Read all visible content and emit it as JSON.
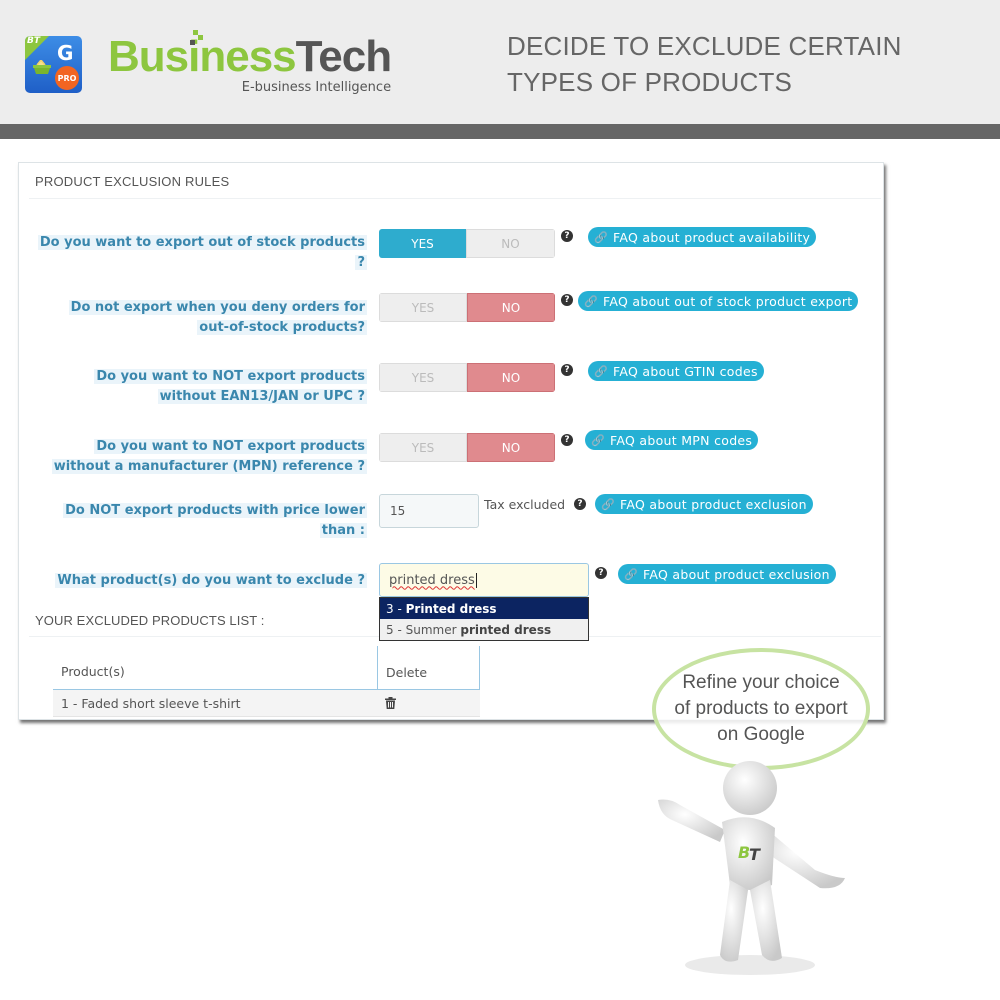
{
  "header": {
    "app_icon": {
      "corner_badge": "BT",
      "letter": "G",
      "badge": "PRO"
    },
    "logo": {
      "part1": "Business",
      "part2": "Tech",
      "tagline": "E-business Intelligence"
    },
    "headline_line1": "DECIDE TO EXCLUDE CERTAIN",
    "headline_line2": "TYPES OF PRODUCTS"
  },
  "panel": {
    "title": "PRODUCT EXCLUSION RULES",
    "rules": [
      {
        "label_line1": "Do you want to export out of stock products",
        "label_line2": "?",
        "yes": "YES",
        "no": "NO",
        "selected": "YES",
        "help": "?",
        "faq": "FAQ about product availability"
      },
      {
        "label_line1": "Do not export when you deny orders for",
        "label_line2": "out-of-stock products?",
        "yes": "YES",
        "no": "NO",
        "selected": "NO",
        "help": "?",
        "faq": "FAQ about out of stock product export"
      },
      {
        "label_line1": "Do you want to NOT export products",
        "label_line2": "without EAN13/JAN or UPC ?",
        "yes": "YES",
        "no": "NO",
        "selected": "NO",
        "help": "?",
        "faq": "FAQ about GTIN codes"
      },
      {
        "label_line1": "Do you want to NOT export products",
        "label_line2": "without a manufacturer (MPN) reference ?",
        "yes": "YES",
        "no": "NO",
        "selected": "NO",
        "help": "?",
        "faq": "FAQ about MPN codes"
      }
    ],
    "price_rule": {
      "label_line1": "Do NOT export products with price lower",
      "label_line2": "than :",
      "value": "15",
      "unit": "Tax excluded",
      "help": "?",
      "faq": "FAQ about product exclusion"
    },
    "exclude_rule": {
      "label": "What product(s) do you want to exclude ?",
      "value": "printed dress",
      "help": "?",
      "faq": "FAQ about product exclusion",
      "suggestions": [
        {
          "prefix": "3 - ",
          "plain": "",
          "match": "Printed dress",
          "active": true
        },
        {
          "prefix": "5 - ",
          "plain": "Summer ",
          "match": "printed dress",
          "active": false
        }
      ]
    },
    "excluded_list": {
      "title": "YOUR EXCLUDED PRODUCTS LIST :",
      "columns": [
        "Product(s)",
        "Delete"
      ],
      "rows": [
        {
          "product": "1 - Faded short sleeve t-shirt",
          "delete_icon": "trash-icon"
        }
      ]
    }
  },
  "mascot": {
    "bubble_line1": "Refine your choice",
    "bubble_line2": "of products to export",
    "bubble_line3": "on Google",
    "shirt_logo_b": "B",
    "shirt_logo_t": "T"
  },
  "colors": {
    "brand_green": "#8dc63f",
    "brand_gray": "#555555",
    "label_blue": "#3a87ad",
    "yes_active": "#2eacce",
    "no_active": "#e08a8e",
    "faq_badge": "#25b0d4",
    "dropdown_active": "#0c2461"
  }
}
